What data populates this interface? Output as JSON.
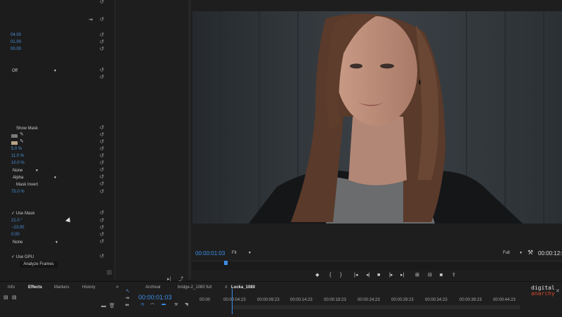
{
  "effect_controls": {
    "position_values": [
      "04.00",
      "01.00",
      "00.00"
    ],
    "off_dropdown": "Off",
    "show_mask_label": "Show Mask",
    "feather_values": [
      "5.0 %",
      "11.0 %",
      "10.0 %"
    ],
    "none_dropdown_1": "None",
    "alpha_dropdown": "Alpha",
    "mask_invert_label": "Mask Invert",
    "opacity_value": "75.0 %",
    "use_mask_label": "Use Mask",
    "mask_values": [
      "21.0 °",
      "−23.00",
      "0.00"
    ],
    "none_dropdown_2": "None",
    "use_gpu_label": "Use GPU",
    "analyze_frames_button": "Analyze Frames",
    "swatch_color_1": "#7a7a7a",
    "swatch_color_2": "#b8a487"
  },
  "program_monitor": {
    "timecode": "00:00:01:03",
    "fit_dropdown": "Fit",
    "quality_dropdown": "Full",
    "end_timecode": "00:00:12:0",
    "accent_color": "#3c8ee8"
  },
  "bottom_panels": {
    "left_tabs": [
      "Info",
      "Effects",
      "Markers",
      "History"
    ],
    "sequence_tabs": [
      "Archival",
      "bridge-2_1080 full",
      "Lucka_1080"
    ],
    "timeline_timecode": "00:00:01:03",
    "ruler_labels": [
      "00:00",
      "00:00:04:23",
      "00:00:09:23",
      "00:00:14:23",
      "00:00:19:23",
      "00:00:24:23",
      "00:00:29:23",
      "00:00:34:23",
      "00:00:39:23",
      "00:00:44:23"
    ],
    "watermark_line1": "digital",
    "watermark_line2": "anarchy"
  }
}
